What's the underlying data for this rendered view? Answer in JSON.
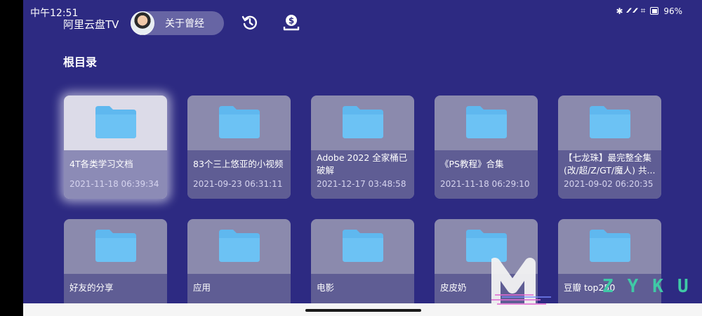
{
  "status": {
    "time": "中午12:51",
    "battery": "96%"
  },
  "header": {
    "app_title": "阿里云盘TV",
    "profile_name": "关于曾经"
  },
  "section_title": "根目录",
  "folders": [
    {
      "name": "4T各类学习文档",
      "date": "2021-11-18 06:39:34",
      "focused": true
    },
    {
      "name": "83个三上悠亚的小视频",
      "date": "2021-09-23 06:31:11"
    },
    {
      "name": "Adobe 2022 全家桶已破解",
      "date": "2021-12-17 03:48:58"
    },
    {
      "name": "《PS教程》合集",
      "date": "2021-11-18 06:29:10"
    },
    {
      "name": "【七龙珠】最完整全集(改/超/Z/GT/魔人) 共...",
      "date": "2021-09-02 06:20:35"
    },
    {
      "name": "好友的分享",
      "date": ""
    },
    {
      "name": "应用",
      "date": ""
    },
    {
      "name": "电影",
      "date": ""
    },
    {
      "name": "皮皮奶",
      "date": ""
    },
    {
      "name": "豆瓣 top250",
      "date": ""
    }
  ],
  "watermark": {
    "text": "ZYKU"
  },
  "colors": {
    "background": "#2d2a82",
    "folder_icon": "#5fb8ef",
    "card_bottom": "#5f5d94",
    "watermark_accent": "#3fc9a6"
  },
  "icons": {
    "history": "history-icon",
    "download": "download-icon",
    "folder": "folder-icon"
  }
}
